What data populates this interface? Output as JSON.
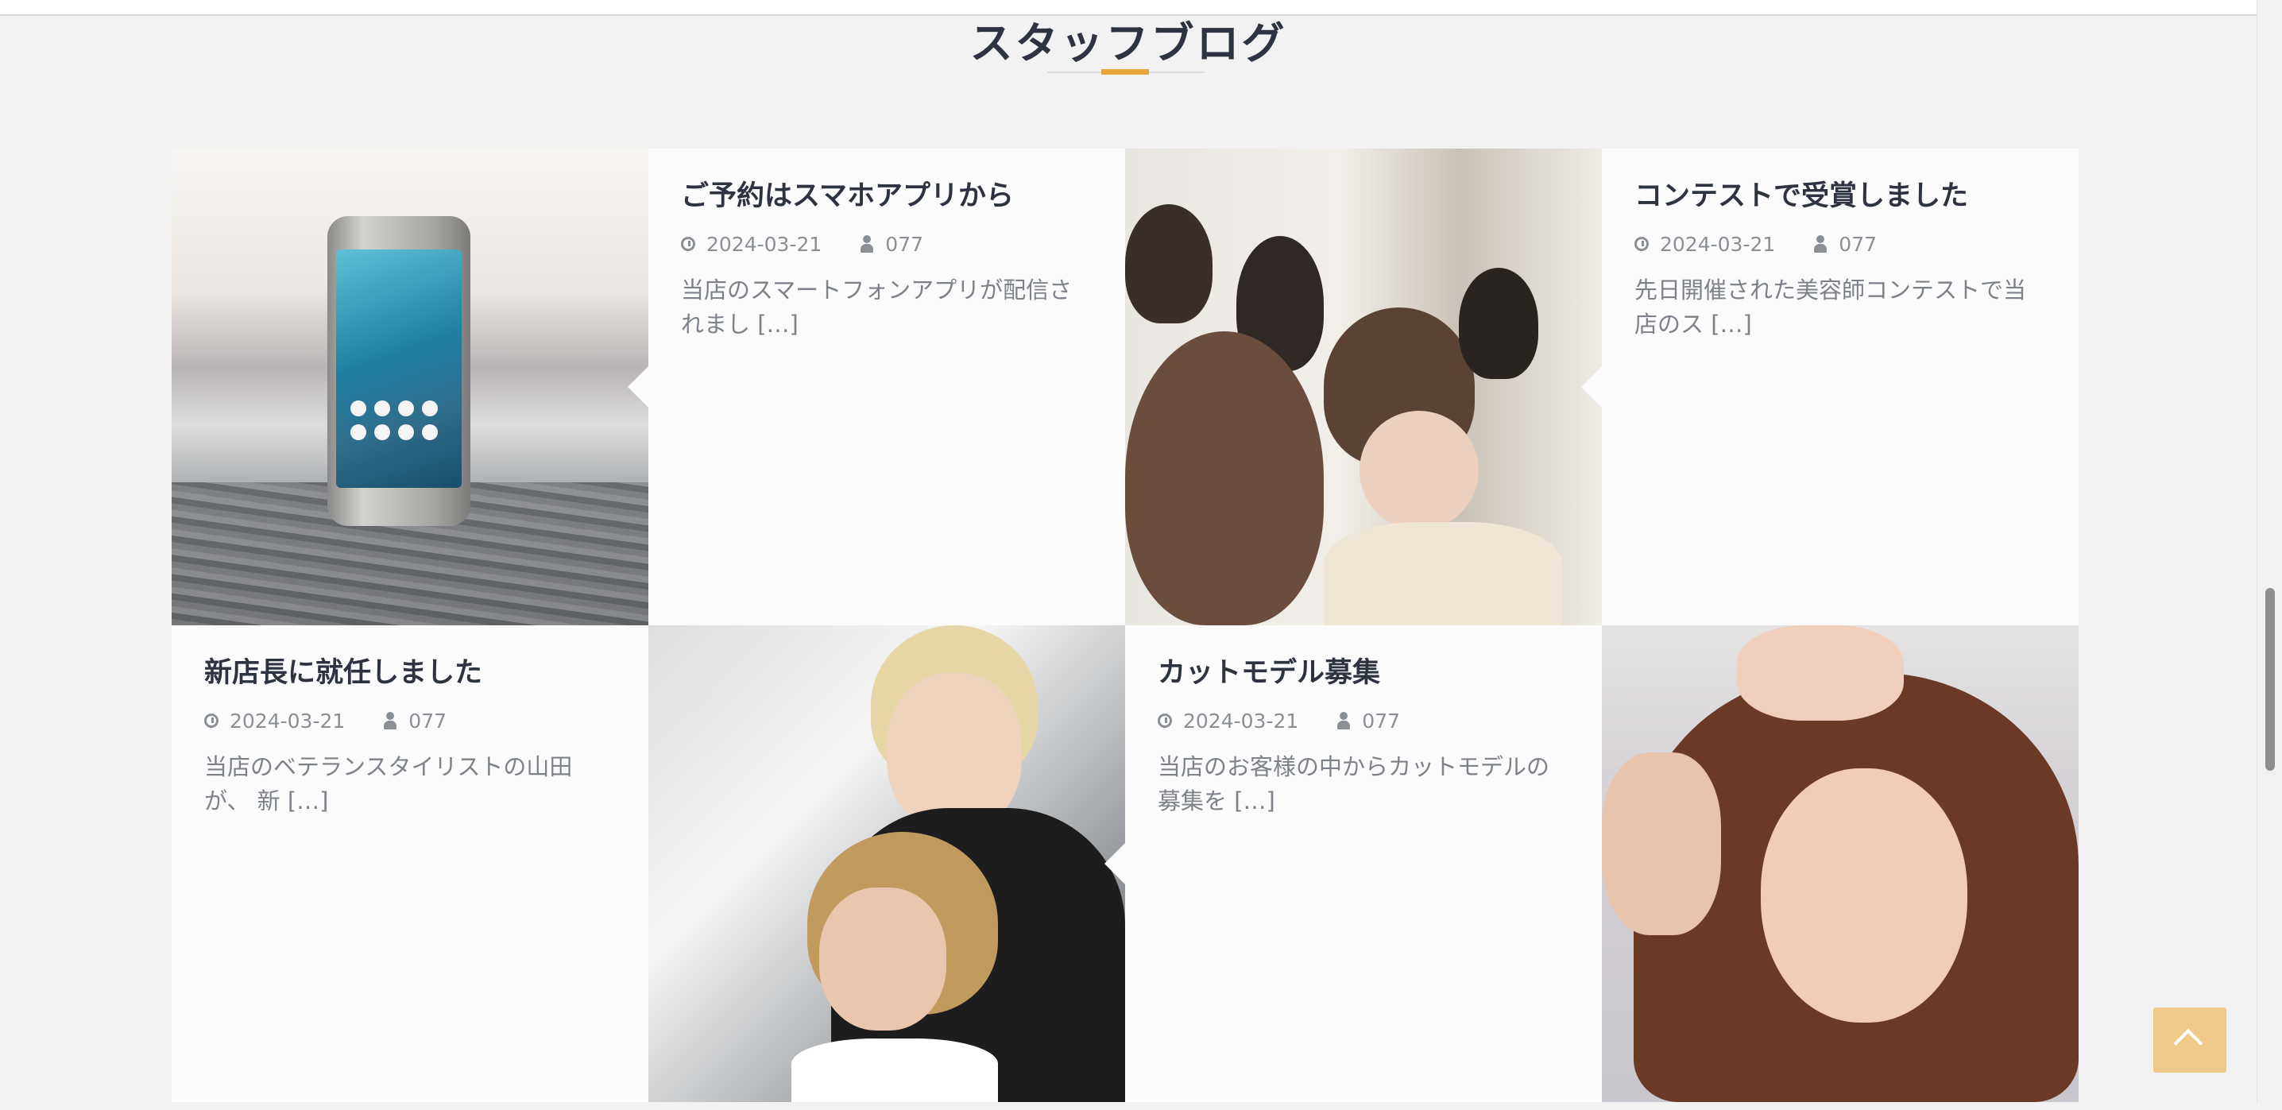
{
  "section": {
    "title": "スタッフブログ"
  },
  "posts": [
    {
      "title": "ご予約はスマホアプリから",
      "date": "2024-03-21",
      "author": "077",
      "excerpt": "当店のスマートフォンアプリが配信されまし […]"
    },
    {
      "title": "コンテストで受賞しました",
      "date": "2024-03-21",
      "author": "077",
      "excerpt": "先日開催された美容師コンテストで当店のス […]"
    },
    {
      "title": "新店長に就任しました",
      "date": "2024-03-21",
      "author": "077",
      "excerpt": "当店のベテランスタイリストの山田が、 新 […]"
    },
    {
      "title": "カットモデル募集",
      "date": "2024-03-21",
      "author": "077",
      "excerpt": "当店のお客様の中からカットモデルの募集を […]"
    }
  ],
  "colors": {
    "accent": "#e9a53c",
    "back_to_top": "#eec98a",
    "card_bg": "#fbfbfb",
    "page_bg": "#f2f2f2"
  },
  "icons": {
    "date": "clock-icon",
    "author": "user-icon",
    "back_to_top": "chevron-up-icon"
  }
}
